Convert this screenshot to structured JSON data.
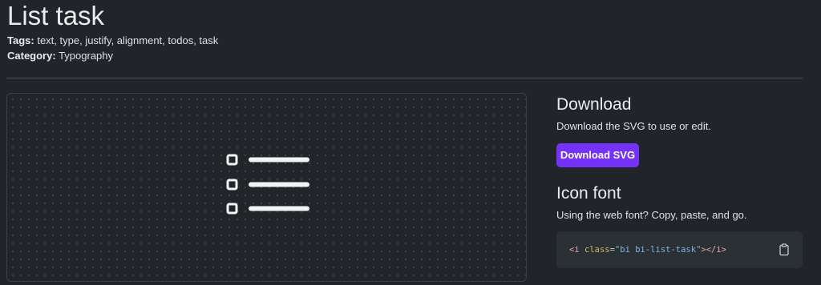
{
  "page": {
    "title": "List task",
    "tags_label": "Tags:",
    "tags": "text, type, justify, alignment, todos, task",
    "category_label": "Category:",
    "category": "Typography"
  },
  "preview": {
    "icon": "list-task-icon"
  },
  "download": {
    "heading": "Download",
    "description": "Download the SVG to use or edit.",
    "button_label": "Download SVG"
  },
  "icon_font": {
    "heading": "Icon font",
    "description": "Using the web font? Copy, paste, and go.",
    "code": {
      "open_tag": "<i",
      "attr": "class",
      "equals": "=",
      "value": "\"bi bi-list-task\"",
      "close_bracket": ">",
      "close_tag": "</i>"
    },
    "copy_icon": "clipboard-icon"
  },
  "colors": {
    "background": "#212529",
    "accent": "#7532f9",
    "code_background": "#2b3035"
  }
}
